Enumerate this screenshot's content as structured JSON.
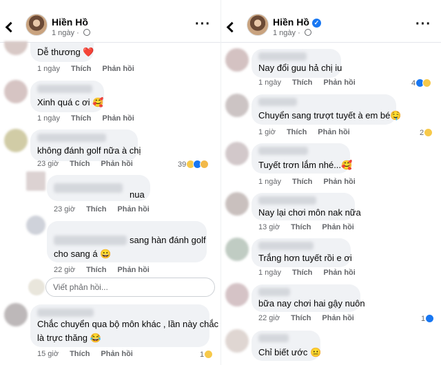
{
  "left": {
    "header": {
      "name": "Hiền Hồ",
      "time": "1 ngày",
      "verified": false
    },
    "comments": [
      {
        "text": "Dễ thương ❤️",
        "time": "1 ngày",
        "like": "Thích",
        "reply": "Phản hồi"
      },
      {
        "text": "Xinh quá c ơi 🥰",
        "time": "1 ngày",
        "like": "Thích",
        "reply": "Phản hồi"
      },
      {
        "text": "không đánh golf nữa à chị",
        "time": "23 giờ",
        "like": "Thích",
        "reply": "Phản hồi",
        "reactions": "39"
      },
      {
        "text": "nua",
        "time": "23 giờ",
        "like": "Thích",
        "reply": "Phản hồi"
      },
      {
        "text_line1": "sang hàn đánh golf",
        "text_line2": "cho sang á 😀",
        "time": "22 giờ",
        "like": "Thích",
        "reply": "Phản hồi"
      },
      {
        "text_line1": "Chắc chuyển qua bộ môn khác , lần này chắc",
        "text_line2": "là trực thăng 😂",
        "time": "15 giờ",
        "like": "Thích",
        "reply": "Phản hồi",
        "reactions": "1"
      }
    ],
    "reply_placeholder": "Viết phản hồi..."
  },
  "right": {
    "header": {
      "name": "Hiền Hồ",
      "time": "1 ngày",
      "verified": true
    },
    "comments": [
      {
        "text": "Nay đổi guu hả chị iu",
        "time": "1 ngày",
        "like": "Thích",
        "reply": "Phản hồi",
        "reactions": "4"
      },
      {
        "text": "Chuyển sang trượt tuyết à em bé🤤",
        "time": "1 giờ",
        "like": "Thích",
        "reply": "Phản hồi",
        "reactions": "2"
      },
      {
        "text": "Tuyết trơn lắm nhé...🥰",
        "time": "1 ngày",
        "like": "Thích",
        "reply": "Phản hồi"
      },
      {
        "text": "Nay lại chơi môn nak nữa",
        "time": "13 giờ",
        "like": "Thích",
        "reply": "Phản hồi"
      },
      {
        "text": "Trắng hơn tuyết rồi e ơi",
        "time": "1 ngày",
        "like": "Thích",
        "reply": "Phản hồi"
      },
      {
        "text": "bữa nay chơi hai gậy nuôn",
        "time": "22 giờ",
        "like": "Thích",
        "reply": "Phản hồi",
        "reactions": "1"
      },
      {
        "text": "Chỉ biết ước 😐",
        "time": "",
        "like": "",
        "reply": ""
      }
    ]
  },
  "icons": {
    "back": "chevron-left-icon",
    "more": "more-dots-icon",
    "globe": "globe-icon",
    "verified": "verified-badge-icon"
  },
  "colors": {
    "bubble": "#f0f2f5",
    "meta": "#65676b",
    "like_blue": "#1877f2"
  }
}
